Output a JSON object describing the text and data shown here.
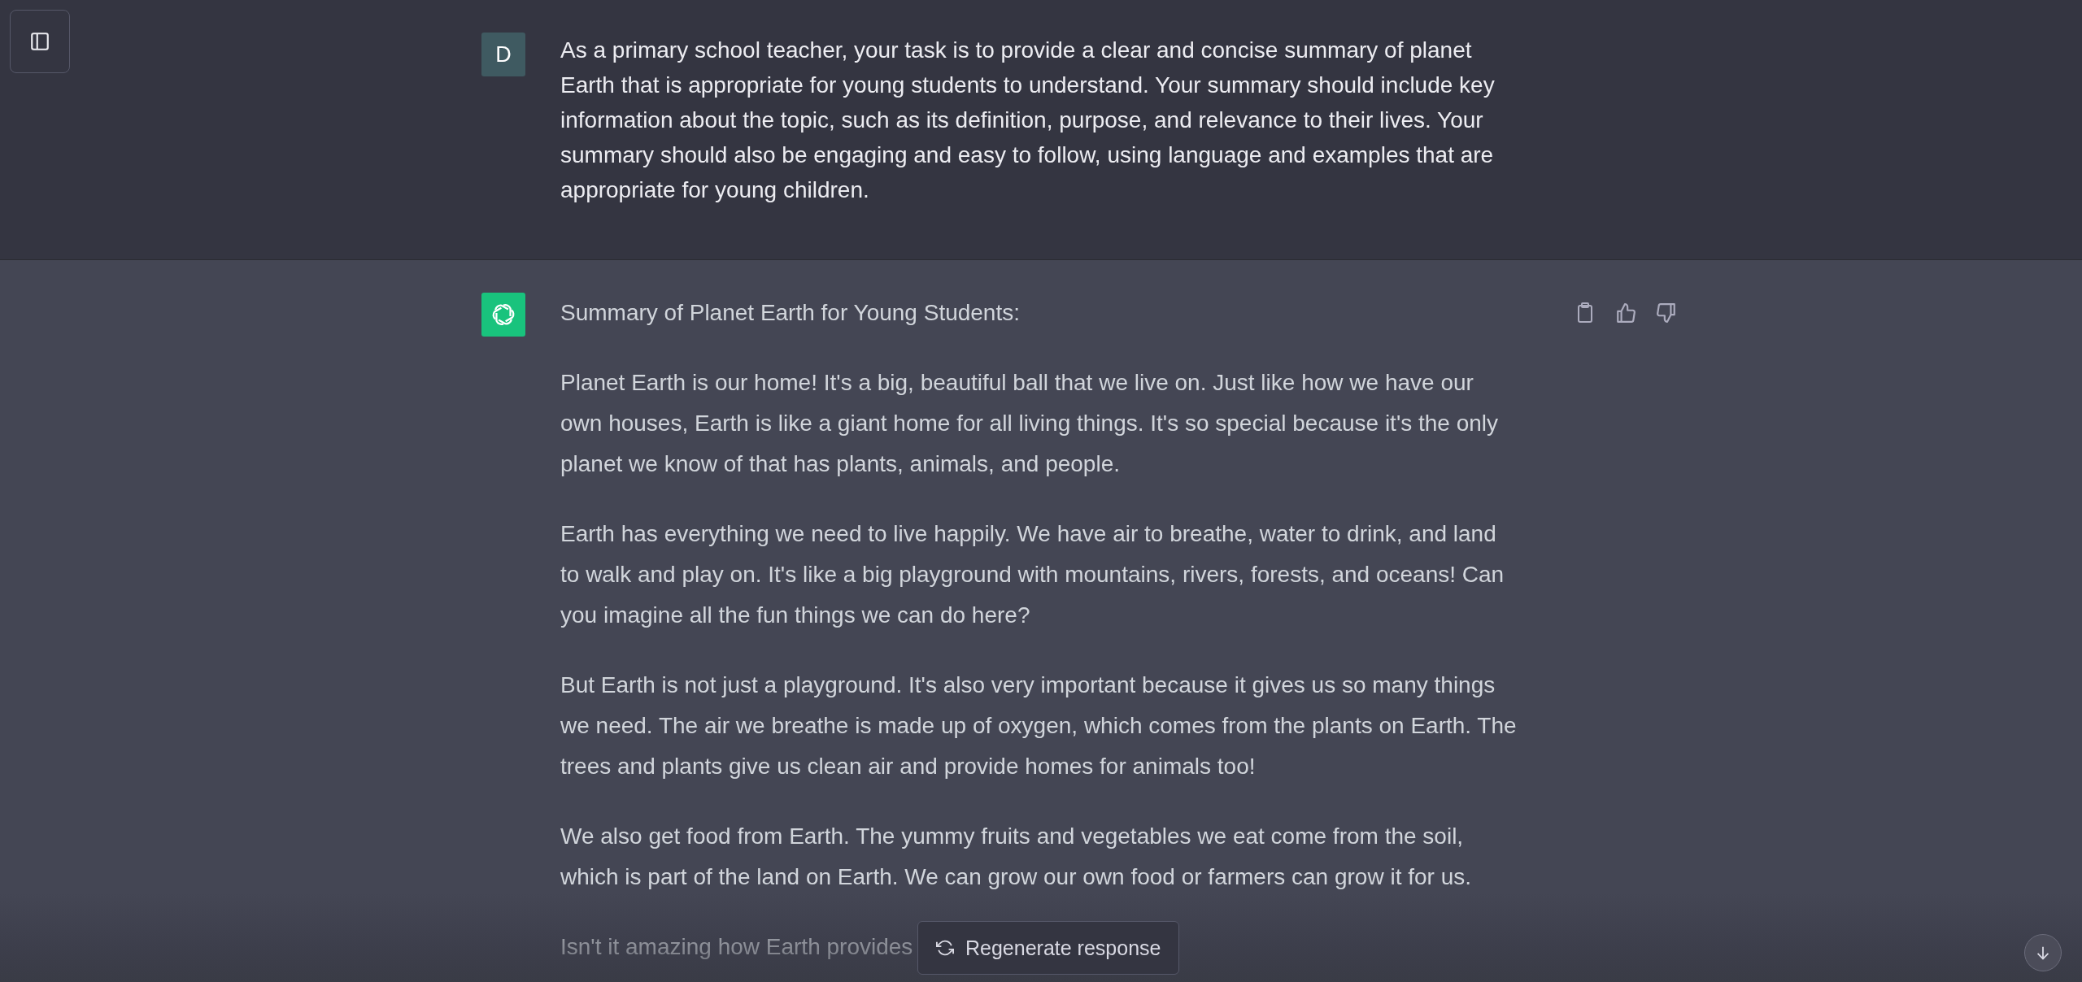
{
  "messages": [
    {
      "kind": "user",
      "avatar": "D",
      "paragraphs": [
        "As a primary school teacher, your task is to provide a clear and concise summary of planet Earth that is appropriate for young students to understand. Your summary should include key information about the topic, such as its definition, purpose, and relevance to their lives. Your summary should also be engaging and easy to follow, using language and examples that are appropriate for young children."
      ]
    },
    {
      "kind": "assistant",
      "paragraphs": [
        "Summary of Planet Earth for Young Students:",
        "Planet Earth is our home! It's a big, beautiful ball that we live on. Just like how we have our own houses, Earth is like a giant home for all living things. It's so special because it's the only planet we know of that has plants, animals, and people.",
        "Earth has everything we need to live happily. We have air to breathe, water to drink, and land to walk and play on. It's like a big playground with mountains, rivers, forests, and oceans! Can you imagine all the fun things we can do here?",
        "But Earth is not just a playground. It's also very important because it gives us so many things we need. The air we breathe is made up of oxygen, which comes from the plants on Earth. The trees and plants give us clean air and provide homes for animals too!",
        "We also get food from Earth. The yummy fruits and vegetables we eat come from the soil, which is part of the land on Earth. We can grow our own food or farmers can grow it for us.",
        "Isn't it amazing how Earth provides"
      ]
    }
  ],
  "regenerate_button": {
    "label": "Regenerate response"
  }
}
